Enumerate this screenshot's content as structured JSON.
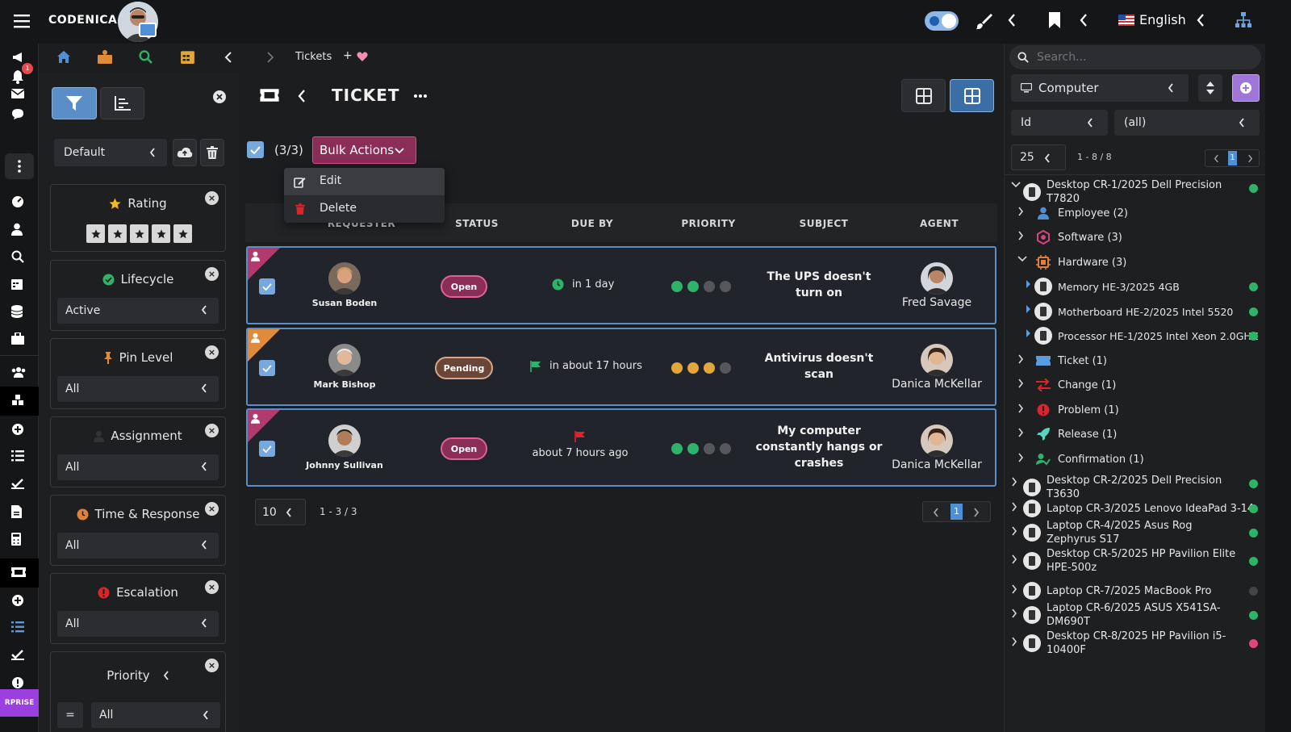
{
  "app": {
    "brand": "CODENICA"
  },
  "topbar": {
    "language": "English"
  },
  "breadcrumb": {
    "current": "Tickets",
    "add": "+"
  },
  "notifications": {
    "count": "1"
  },
  "filters": {
    "view_select": "Default",
    "cards": [
      {
        "title": "Rating",
        "value": ""
      },
      {
        "title": "Lifecycle",
        "value": "Active"
      },
      {
        "title": "Pin Level",
        "value": "All"
      },
      {
        "title": "Assignment",
        "value": "All"
      },
      {
        "title": "Time & Response",
        "value": "All"
      },
      {
        "title": "Escalation",
        "value": "All"
      },
      {
        "title": "Priority",
        "value": "All",
        "operator": "="
      }
    ]
  },
  "enterprise_badge": "RPRISE",
  "main": {
    "title": "TICKET",
    "selection_count": "(3/3)",
    "bulk_actions_label": "Bulk Actions",
    "bulk_menu": [
      {
        "label": "Edit"
      },
      {
        "label": "Delete"
      }
    ],
    "columns": [
      "REQUESTER",
      "STATUS",
      "DUE BY",
      "PRIORITY",
      "SUBJECT",
      "AGENT"
    ],
    "rows": [
      {
        "requester": "Susan Boden",
        "status": "Open",
        "due": "in 1 day",
        "priority_level": 1,
        "priority_color": "#2fb36a",
        "subject": "The UPS doesn't turn on",
        "agent": "Fred Savage",
        "corner_color": "#b23a6e"
      },
      {
        "requester": "Mark Bishop",
        "status": "Pending",
        "due": "in about 17 hours",
        "priority_level": 2,
        "priority_color": "#e2a63a",
        "subject": "Antivirus doesn't scan",
        "agent": "Danica McKellar",
        "corner_color": "#e08a3a"
      },
      {
        "requester": "Johnny Sullivan",
        "status": "Open",
        "due": "about 7 hours ago",
        "priority_level": 1,
        "priority_color": "#2fb36a",
        "subject": "My computer constantly hangs or crashes",
        "agent": "Danica McKellar",
        "corner_color": "#b23a6e"
      }
    ],
    "page_size": "10",
    "page_range": "1 - 3 / 3",
    "page_current": "1"
  },
  "right_panel": {
    "search_placeholder": "Search...",
    "type_select": "Computer",
    "field_select": "Id",
    "value_select": "(all)",
    "page_size": "25",
    "page_range": "1 - 8 / 8",
    "page_current": "1",
    "tree": [
      {
        "label": "Desktop CR-1/2025 Dell Precision T7820",
        "status": "#2fb36a"
      },
      {
        "label": "Employee (2)"
      },
      {
        "label": "Software (3)"
      },
      {
        "label": "Hardware (3)"
      },
      {
        "label": "Memory HE-3/2025 4GB",
        "status": "#2fb36a"
      },
      {
        "label": "Motherboard HE-2/2025 Intel 5520",
        "status": "#2fb36a"
      },
      {
        "label": "Processor HE-1/2025 Intel Xeon 2.0GHZ",
        "status": "#2fb36a"
      },
      {
        "label": "Ticket (1)"
      },
      {
        "label": "Change (1)"
      },
      {
        "label": "Problem (1)"
      },
      {
        "label": "Release (1)"
      },
      {
        "label": "Confirmation (1)"
      },
      {
        "label": "Desktop CR-2/2025 Dell Precision T3630",
        "status": "#2fb36a"
      },
      {
        "label": "Laptop CR-3/2025 Lenovo IdeaPad 3-14",
        "status": "#2fb36a"
      },
      {
        "label": "Laptop CR-4/2025 Asus Rog Zephyrus S17",
        "status": "#2fb36a"
      },
      {
        "label": "Desktop CR-5/2025 HP Pavilion Elite HPE-500z",
        "status": "#2fb36a"
      },
      {
        "label": "Laptop CR-7/2025 MacBook Pro",
        "status": "#444"
      },
      {
        "label": "Laptop CR-6/2025 ASUS X541SA-DM690T",
        "status": "#2fb36a"
      },
      {
        "label": "Desktop CR-8/2025 HP Pavilion i5-10400F",
        "status": "#e0457b"
      }
    ]
  }
}
